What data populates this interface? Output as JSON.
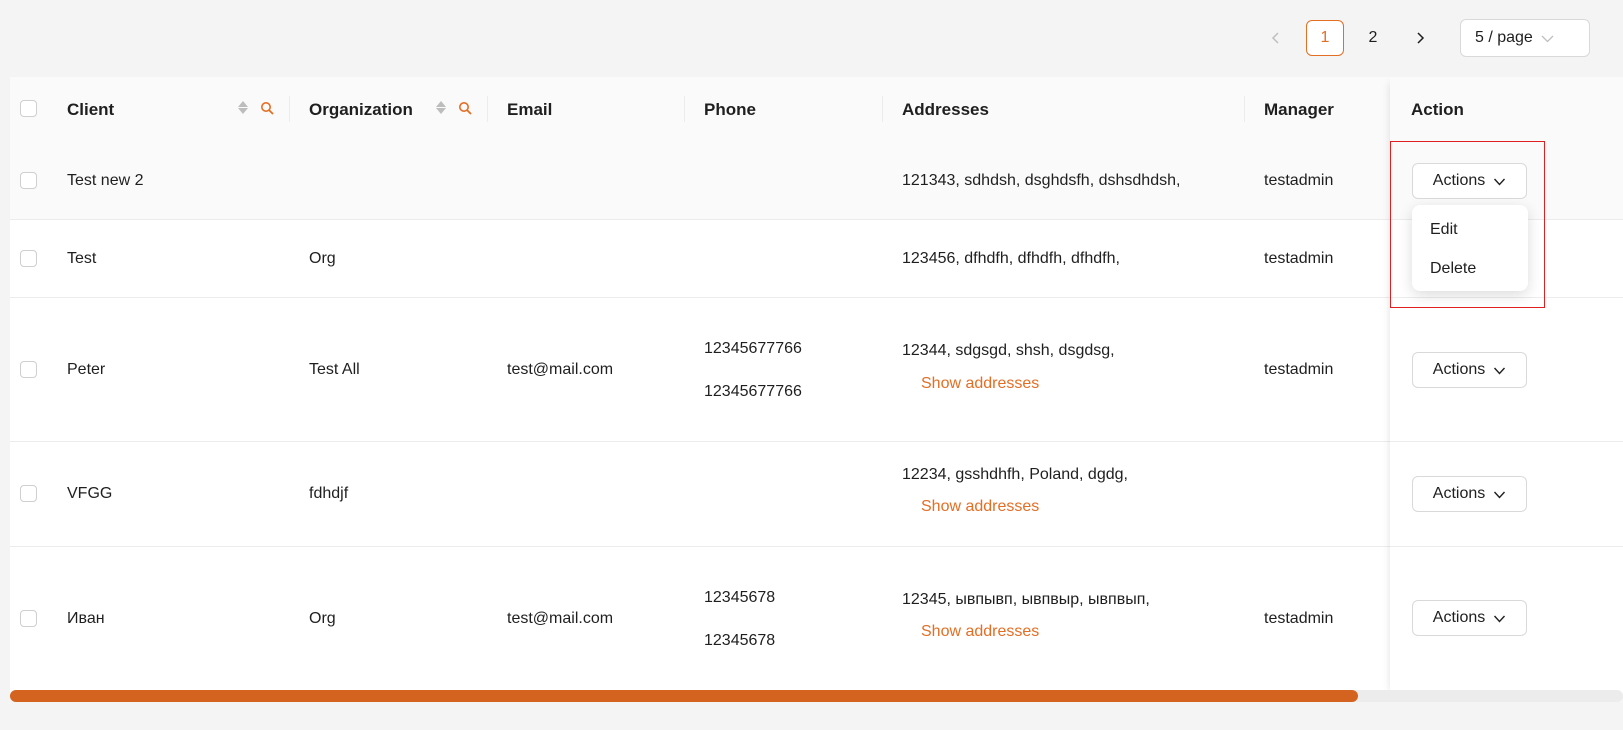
{
  "pagination": {
    "pages": [
      "1",
      "2"
    ],
    "current_page": "1",
    "page_size": "5 / page",
    "prev_icon": "chevron-left-icon",
    "next_icon": "chevron-right-icon"
  },
  "table": {
    "columns": {
      "client": "Client",
      "organization": "Organization",
      "email": "Email",
      "phone": "Phone",
      "addresses": "Addresses",
      "manager": "Manager",
      "action": "Action"
    },
    "rows": [
      {
        "client": "Test new 2",
        "organization": "",
        "email": "",
        "phones": [],
        "address": "121343, sdhdsh, dsghdsfh, dshsdhdsh,",
        "show_addresses": "",
        "manager": "testadmin",
        "action_label": "Actions"
      },
      {
        "client": "Test",
        "organization": "Org",
        "email": "",
        "phones": [],
        "address": "123456, dfhdfh, dfhdfh, dfhdfh,",
        "show_addresses": "",
        "manager": "testadmin",
        "action_label": "Actions"
      },
      {
        "client": "Peter",
        "organization": "Test All",
        "email": "test@mail.com",
        "phones": [
          "12345677766",
          "12345677766"
        ],
        "address": "12344, sdgsgd, shsh, dsgdsg,",
        "show_addresses": "Show addresses",
        "manager": "testadmin",
        "action_label": "Actions"
      },
      {
        "client": "VFGG",
        "organization": "fdhdjf",
        "email": "",
        "phones": [],
        "address": "12234, gsshdhfh, Poland, dgdg,",
        "show_addresses": "Show addresses",
        "manager": "",
        "action_label": "Actions"
      },
      {
        "client": "Иван",
        "organization": "Org",
        "email": "test@mail.com",
        "phones": [
          "12345678",
          "12345678"
        ],
        "address": "12345, ывпывп, ывпвыр, ывпвып,",
        "show_addresses": "Show addresses",
        "manager": "testadmin",
        "action_label": "Actions"
      }
    ]
  },
  "dropdown": {
    "items": [
      "Edit",
      "Delete"
    ]
  },
  "colors": {
    "accent": "#e36e24",
    "scrollbar": "#d4631f",
    "highlight": "#e02020"
  }
}
